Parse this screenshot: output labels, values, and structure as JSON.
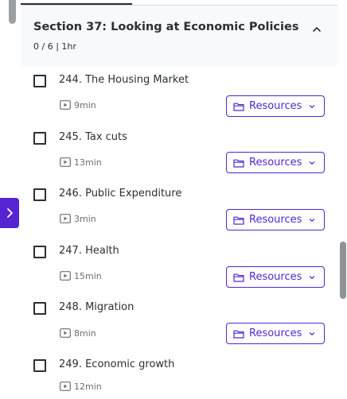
{
  "section": {
    "title": "Section 37: Looking at Economic Policies",
    "meta": "0 / 6 | 1hr"
  },
  "lectures": [
    {
      "title": "244. The Housing Market",
      "duration": "9min",
      "resources_label": "Resources"
    },
    {
      "title": "245. Tax cuts",
      "duration": "13min",
      "resources_label": "Resources"
    },
    {
      "title": "246. Public Expenditure",
      "duration": "3min",
      "resources_label": "Resources"
    },
    {
      "title": "247. Health",
      "duration": "15min",
      "resources_label": "Resources"
    },
    {
      "title": "248. Migration",
      "duration": "8min",
      "resources_label": "Resources"
    },
    {
      "title": "249. Economic growth",
      "duration": "12min",
      "resources_label": ""
    }
  ],
  "icons": {
    "collapse": "chevron-up-icon",
    "video": "video-icon",
    "folder": "folder-icon",
    "dropdown": "chevron-down-icon",
    "sidebar_toggle": "chevron-right-icon"
  },
  "colors": {
    "accent": "#5624d0",
    "header_bg": "#f7f9fa",
    "text": "#2d2f31",
    "muted": "#6a6f73"
  }
}
